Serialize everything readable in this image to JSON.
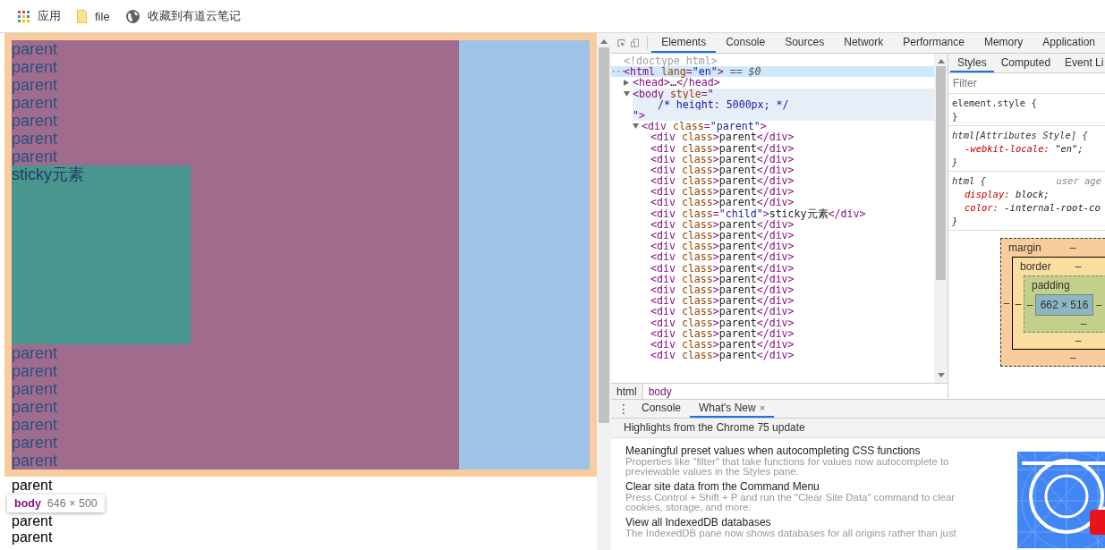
{
  "bookmarks": [
    {
      "kind": "apps",
      "label": "应用"
    },
    {
      "kind": "folder",
      "label": "file"
    },
    {
      "kind": "globe",
      "label": "收藏到有道云笔记"
    }
  ],
  "page": {
    "lines_above": [
      "parent",
      "parent",
      "parent",
      "parent",
      "parent",
      "parent",
      "parent"
    ],
    "sticky_text": "sticky元素",
    "lines_below": [
      "parent",
      "parent",
      "parent",
      "parent",
      "parent",
      "parent",
      "parent"
    ],
    "lines_after": [
      "parent",
      "parent",
      "parent"
    ],
    "tooltip": {
      "tag": "body",
      "size": "646 × 500"
    }
  },
  "devtools": {
    "tabs": [
      {
        "label": "Elements",
        "selected": true
      },
      {
        "label": "Console",
        "selected": false
      },
      {
        "label": "Sources",
        "selected": false
      },
      {
        "label": "Network",
        "selected": false
      },
      {
        "label": "Performance",
        "selected": false
      },
      {
        "label": "Memory",
        "selected": false
      },
      {
        "label": "Application",
        "selected": false
      }
    ],
    "dom_tree": [
      {
        "lines": [
          [
            {
              "kind": "doctype",
              "text": "<!doctype html>"
            }
          ]
        ],
        "selected": false,
        "hovered": false
      },
      {
        "gutter": "···",
        "lines": [
          [
            {
              "kind": "tag",
              "text": "<html"
            },
            {
              "kind": "attr",
              "text": " lang"
            },
            {
              "kind": "tag",
              "text": "="
            },
            {
              "kind": "value",
              "text": "\"en\""
            },
            {
              "kind": "tag",
              "text": ">"
            },
            {
              "kind": "marker",
              "text": " == $0"
            }
          ]
        ],
        "selected": true,
        "hovered": false,
        "children": [
          {
            "lines": [
              [
                {
                  "kind": "tag",
                  "text": "<head>"
                },
                {
                  "kind": "text",
                  "text": "…"
                },
                {
                  "kind": "tag",
                  "text": "</head>"
                }
              ]
            ],
            "expanded": false,
            "selected": false,
            "hovered": false
          },
          {
            "lines": [
              [
                {
                  "kind": "tag",
                  "text": "<body"
                },
                {
                  "kind": "attr",
                  "text": " style"
                },
                {
                  "kind": "tag",
                  "text": "="
                },
                {
                  "kind": "value",
                  "text": "\""
                }
              ],
              [
                {
                  "kind": "value",
                  "text": "    /* height: 5000px; */"
                }
              ],
              [
                {
                  "kind": "value",
                  "text": "\""
                },
                {
                  "kind": "tag",
                  "text": ">"
                }
              ]
            ],
            "expanded": true,
            "selected": false,
            "hovered": true,
            "children": [
              {
                "lines": [
                  [
                    {
                      "kind": "tag",
                      "text": "<div"
                    },
                    {
                      "kind": "attr",
                      "text": " class"
                    },
                    {
                      "kind": "tag",
                      "text": "="
                    },
                    {
                      "kind": "value",
                      "text": "\"parent\""
                    },
                    {
                      "kind": "tag",
                      "text": ">"
                    }
                  ]
                ],
                "expanded": true,
                "selected": false,
                "hovered": false,
                "children": [
                  {
                    "lines": [
                      [
                        {
                          "kind": "tag",
                          "text": "<div"
                        },
                        {
                          "kind": "attr",
                          "text": " class"
                        },
                        {
                          "kind": "tag",
                          "text": ">"
                        },
                        {
                          "kind": "text",
                          "text": "parent"
                        },
                        {
                          "kind": "tag",
                          "text": "</div>"
                        }
                      ]
                    ],
                    "selected": false,
                    "hovered": false
                  },
                  {
                    "lines": [
                      [
                        {
                          "kind": "tag",
                          "text": "<div"
                        },
                        {
                          "kind": "attr",
                          "text": " class"
                        },
                        {
                          "kind": "tag",
                          "text": ">"
                        },
                        {
                          "kind": "text",
                          "text": "parent"
                        },
                        {
                          "kind": "tag",
                          "text": "</div>"
                        }
                      ]
                    ],
                    "selected": false,
                    "hovered": false
                  },
                  {
                    "lines": [
                      [
                        {
                          "kind": "tag",
                          "text": "<div"
                        },
                        {
                          "kind": "attr",
                          "text": " class"
                        },
                        {
                          "kind": "tag",
                          "text": ">"
                        },
                        {
                          "kind": "text",
                          "text": "parent"
                        },
                        {
                          "kind": "tag",
                          "text": "</div>"
                        }
                      ]
                    ],
                    "selected": false,
                    "hovered": false
                  },
                  {
                    "lines": [
                      [
                        {
                          "kind": "tag",
                          "text": "<div"
                        },
                        {
                          "kind": "attr",
                          "text": " class"
                        },
                        {
                          "kind": "tag",
                          "text": ">"
                        },
                        {
                          "kind": "text",
                          "text": "parent"
                        },
                        {
                          "kind": "tag",
                          "text": "</div>"
                        }
                      ]
                    ],
                    "selected": false,
                    "hovered": false
                  },
                  {
                    "lines": [
                      [
                        {
                          "kind": "tag",
                          "text": "<div"
                        },
                        {
                          "kind": "attr",
                          "text": " class"
                        },
                        {
                          "kind": "tag",
                          "text": ">"
                        },
                        {
                          "kind": "text",
                          "text": "parent"
                        },
                        {
                          "kind": "tag",
                          "text": "</div>"
                        }
                      ]
                    ],
                    "selected": false,
                    "hovered": false
                  },
                  {
                    "lines": [
                      [
                        {
                          "kind": "tag",
                          "text": "<div"
                        },
                        {
                          "kind": "attr",
                          "text": " class"
                        },
                        {
                          "kind": "tag",
                          "text": ">"
                        },
                        {
                          "kind": "text",
                          "text": "parent"
                        },
                        {
                          "kind": "tag",
                          "text": "</div>"
                        }
                      ]
                    ],
                    "selected": false,
                    "hovered": false
                  },
                  {
                    "lines": [
                      [
                        {
                          "kind": "tag",
                          "text": "<div"
                        },
                        {
                          "kind": "attr",
                          "text": " class"
                        },
                        {
                          "kind": "tag",
                          "text": ">"
                        },
                        {
                          "kind": "text",
                          "text": "parent"
                        },
                        {
                          "kind": "tag",
                          "text": "</div>"
                        }
                      ]
                    ],
                    "selected": false,
                    "hovered": false
                  },
                  {
                    "lines": [
                      [
                        {
                          "kind": "tag",
                          "text": "<div"
                        },
                        {
                          "kind": "attr",
                          "text": " class"
                        },
                        {
                          "kind": "tag",
                          "text": "="
                        },
                        {
                          "kind": "value",
                          "text": "\"child\""
                        },
                        {
                          "kind": "tag",
                          "text": ">"
                        },
                        {
                          "kind": "text",
                          "text": "sticky元素"
                        },
                        {
                          "kind": "tag",
                          "text": "</div>"
                        }
                      ]
                    ],
                    "selected": false,
                    "hovered": false
                  },
                  {
                    "lines": [
                      [
                        {
                          "kind": "tag",
                          "text": "<div"
                        },
                        {
                          "kind": "attr",
                          "text": " class"
                        },
                        {
                          "kind": "tag",
                          "text": ">"
                        },
                        {
                          "kind": "text",
                          "text": "parent"
                        },
                        {
                          "kind": "tag",
                          "text": "</div>"
                        }
                      ]
                    ],
                    "selected": false,
                    "hovered": false
                  },
                  {
                    "lines": [
                      [
                        {
                          "kind": "tag",
                          "text": "<div"
                        },
                        {
                          "kind": "attr",
                          "text": " class"
                        },
                        {
                          "kind": "tag",
                          "text": ">"
                        },
                        {
                          "kind": "text",
                          "text": "parent"
                        },
                        {
                          "kind": "tag",
                          "text": "</div>"
                        }
                      ]
                    ],
                    "selected": false,
                    "hovered": false
                  },
                  {
                    "lines": [
                      [
                        {
                          "kind": "tag",
                          "text": "<div"
                        },
                        {
                          "kind": "attr",
                          "text": " class"
                        },
                        {
                          "kind": "tag",
                          "text": ">"
                        },
                        {
                          "kind": "text",
                          "text": "parent"
                        },
                        {
                          "kind": "tag",
                          "text": "</div>"
                        }
                      ]
                    ],
                    "selected": false,
                    "hovered": false
                  },
                  {
                    "lines": [
                      [
                        {
                          "kind": "tag",
                          "text": "<div"
                        },
                        {
                          "kind": "attr",
                          "text": " class"
                        },
                        {
                          "kind": "tag",
                          "text": ">"
                        },
                        {
                          "kind": "text",
                          "text": "parent"
                        },
                        {
                          "kind": "tag",
                          "text": "</div>"
                        }
                      ]
                    ],
                    "selected": false,
                    "hovered": false
                  },
                  {
                    "lines": [
                      [
                        {
                          "kind": "tag",
                          "text": "<div"
                        },
                        {
                          "kind": "attr",
                          "text": " class"
                        },
                        {
                          "kind": "tag",
                          "text": ">"
                        },
                        {
                          "kind": "text",
                          "text": "parent"
                        },
                        {
                          "kind": "tag",
                          "text": "</div>"
                        }
                      ]
                    ],
                    "selected": false,
                    "hovered": false
                  },
                  {
                    "lines": [
                      [
                        {
                          "kind": "tag",
                          "text": "<div"
                        },
                        {
                          "kind": "attr",
                          "text": " class"
                        },
                        {
                          "kind": "tag",
                          "text": ">"
                        },
                        {
                          "kind": "text",
                          "text": "parent"
                        },
                        {
                          "kind": "tag",
                          "text": "</div>"
                        }
                      ]
                    ],
                    "selected": false,
                    "hovered": false
                  },
                  {
                    "lines": [
                      [
                        {
                          "kind": "tag",
                          "text": "<div"
                        },
                        {
                          "kind": "attr",
                          "text": " class"
                        },
                        {
                          "kind": "tag",
                          "text": ">"
                        },
                        {
                          "kind": "text",
                          "text": "parent"
                        },
                        {
                          "kind": "tag",
                          "text": "</div>"
                        }
                      ]
                    ],
                    "selected": false,
                    "hovered": false
                  },
                  {
                    "lines": [
                      [
                        {
                          "kind": "tag",
                          "text": "<div"
                        },
                        {
                          "kind": "attr",
                          "text": " class"
                        },
                        {
                          "kind": "tag",
                          "text": ">"
                        },
                        {
                          "kind": "text",
                          "text": "parent"
                        },
                        {
                          "kind": "tag",
                          "text": "</div>"
                        }
                      ]
                    ],
                    "selected": false,
                    "hovered": false
                  },
                  {
                    "lines": [
                      [
                        {
                          "kind": "tag",
                          "text": "<div"
                        },
                        {
                          "kind": "attr",
                          "text": " class"
                        },
                        {
                          "kind": "tag",
                          "text": ">"
                        },
                        {
                          "kind": "text",
                          "text": "parent"
                        },
                        {
                          "kind": "tag",
                          "text": "</div>"
                        }
                      ]
                    ],
                    "selected": false,
                    "hovered": false
                  },
                  {
                    "lines": [
                      [
                        {
                          "kind": "tag",
                          "text": "<div"
                        },
                        {
                          "kind": "attr",
                          "text": " class"
                        },
                        {
                          "kind": "tag",
                          "text": ">"
                        },
                        {
                          "kind": "text",
                          "text": "parent"
                        },
                        {
                          "kind": "tag",
                          "text": "</div>"
                        }
                      ]
                    ],
                    "selected": false,
                    "hovered": false
                  },
                  {
                    "lines": [
                      [
                        {
                          "kind": "tag",
                          "text": "<div"
                        },
                        {
                          "kind": "attr",
                          "text": " class"
                        },
                        {
                          "kind": "tag",
                          "text": ">"
                        },
                        {
                          "kind": "text",
                          "text": "parent"
                        },
                        {
                          "kind": "tag",
                          "text": "</div>"
                        }
                      ]
                    ],
                    "selected": false,
                    "hovered": false
                  },
                  {
                    "lines": [
                      [
                        {
                          "kind": "tag",
                          "text": "<div"
                        },
                        {
                          "kind": "attr",
                          "text": " class"
                        },
                        {
                          "kind": "tag",
                          "text": ">"
                        },
                        {
                          "kind": "text",
                          "text": "parent"
                        },
                        {
                          "kind": "tag",
                          "text": "</div>"
                        }
                      ]
                    ],
                    "selected": false,
                    "hovered": false
                  },
                  {
                    "lines": [
                      [
                        {
                          "kind": "tag",
                          "text": "<div"
                        },
                        {
                          "kind": "attr",
                          "text": " class"
                        },
                        {
                          "kind": "tag",
                          "text": ">"
                        },
                        {
                          "kind": "text",
                          "text": "parent"
                        },
                        {
                          "kind": "tag",
                          "text": "</div>"
                        }
                      ]
                    ],
                    "selected": false,
                    "hovered": false
                  }
                ]
              }
            ]
          }
        ]
      }
    ],
    "breadcrumbs": [
      {
        "label": "html",
        "selected": false
      },
      {
        "label": "body",
        "selected": true
      }
    ],
    "styles": {
      "tabs": [
        {
          "label": "Styles",
          "selected": true
        },
        {
          "label": "Computed",
          "selected": false
        },
        {
          "label": "Event Li",
          "selected": false
        }
      ],
      "filter": {
        "placeholder": "Filter"
      },
      "rules": [
        {
          "selector": "element.style {",
          "editable": true,
          "close": "}"
        },
        {
          "selector": "html[Attributes Style] {",
          "editable": false,
          "declarations": [
            {
              "name": "-webkit-locale:",
              "value": " \"en\";"
            }
          ],
          "close": "}"
        },
        {
          "selector": "html {",
          "editable": false,
          "origin": "user age",
          "declarations": [
            {
              "name": "display:",
              "value": " block;"
            },
            {
              "name": "color:",
              "value": " -internal-root-co"
            }
          ],
          "close": "}"
        }
      ],
      "box_model": {
        "margin": {
          "label": "margin",
          "top": "–",
          "left": "–",
          "bottom": "–"
        },
        "border": {
          "label": "border",
          "top": "–",
          "left": "–",
          "bottom": "–"
        },
        "padding": {
          "label": "padding",
          "left": "–",
          "right": "–",
          "bottom": "–"
        },
        "content": "662 × 516"
      }
    },
    "drawer": {
      "menu": "⋮",
      "tabs": [
        {
          "label": "Console",
          "selected": false
        },
        {
          "label": "What's New",
          "selected": true,
          "close": "×"
        }
      ],
      "header": "Highlights from the Chrome 75 update",
      "features": [
        {
          "title": "Meaningful preset values when autocompleting CSS functions",
          "description": "Properties like \"filter\" that take functions for values now autocomplete to previewable values in the Styles pane."
        },
        {
          "title": "Clear site data from the Command Menu",
          "description": "Press Control + Shift + P and run the \"Clear Site Data\" command to clear cookies, storage, and more."
        },
        {
          "title": "View all IndexedDB databases",
          "description": "The IndexedDB pane now shows databases for all origins rather than just"
        }
      ]
    }
  }
}
